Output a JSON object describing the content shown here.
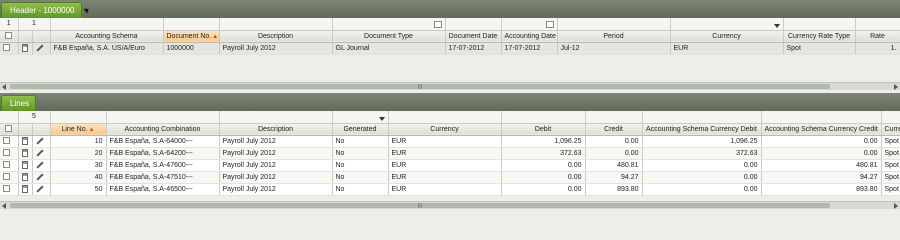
{
  "header": {
    "tab_label": "Header - 1000000",
    "row_counter_left": "1",
    "row_counter_right": "1",
    "columns": [
      "Accounting Schema",
      "Document No.",
      "Description",
      "Document Type",
      "Document Date",
      "Accounting Date",
      "Period",
      "Currency",
      "Currency Rate Type",
      "Rate"
    ],
    "sorted_column": "Document No.",
    "row": {
      "accounting_schema": "F&B España, S.A. US/A/Euro",
      "document_no": "1000000",
      "description": "Payroll July 2012",
      "document_type": "GL Journal",
      "document_date": "17-07-2012",
      "accounting_date": "17-07-2012",
      "period": "Jul-12",
      "currency": "EUR",
      "currency_rate_type": "Spot",
      "rate": "1."
    }
  },
  "lines": {
    "tab_label": "Lines",
    "row_counter": "5",
    "columns": [
      "Line No.",
      "Accounting Combination",
      "Description",
      "Generated",
      "Currency",
      "Debit",
      "Credit",
      "Accounting Schema Currency Debit",
      "Accounting Schema Currency Credit",
      "Currency"
    ],
    "sorted_column": "Line No.",
    "rows": [
      {
        "line_no": "10",
        "combination": "F&B España, S.A-64000---",
        "description": "Payroll July 2012",
        "generated": "No",
        "currency": "EUR",
        "debit": "1,096.25",
        "credit": "0.00",
        "as_debit": "1,096.25",
        "as_credit": "0.00",
        "rate_type": "Spot"
      },
      {
        "line_no": "20",
        "combination": "F&B España, S.A-64200---",
        "description": "Payroll July 2012",
        "generated": "No",
        "currency": "EUR",
        "debit": "372.63",
        "credit": "0.00",
        "as_debit": "372.63",
        "as_credit": "0.00",
        "rate_type": "Spot"
      },
      {
        "line_no": "30",
        "combination": "F&B España, S.A-47600---",
        "description": "Payroll July 2012",
        "generated": "No",
        "currency": "EUR",
        "debit": "0.00",
        "credit": "480.81",
        "as_debit": "0.00",
        "as_credit": "480.81",
        "rate_type": "Spot"
      },
      {
        "line_no": "40",
        "combination": "F&B España, S.A-47510---",
        "description": "Payroll July 2012",
        "generated": "No",
        "currency": "EUR",
        "debit": "0.00",
        "credit": "94.27",
        "as_debit": "0.00",
        "as_credit": "94.27",
        "rate_type": "Spot"
      },
      {
        "line_no": "50",
        "combination": "F&B España, S.A-46500---",
        "description": "Payroll July 2012",
        "generated": "No",
        "currency": "EUR",
        "debit": "0.00",
        "credit": "893.80",
        "as_debit": "0.00",
        "as_credit": "893.80",
        "rate_type": "Spot"
      }
    ]
  },
  "colors": {
    "tab_green": "#5f9624",
    "tabbar_gray": "#636a5c",
    "sorted_header": "#f6c98e"
  }
}
